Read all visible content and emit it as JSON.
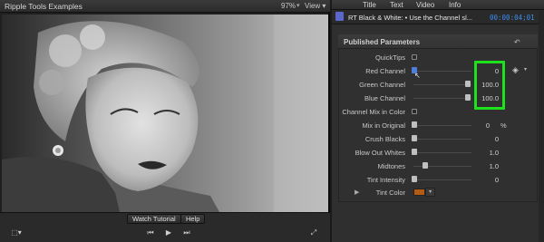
{
  "viewer": {
    "title": "Ripple Tools Examples",
    "zoom": "97%",
    "zoom_caret": "▾",
    "view_menu": "View ▾",
    "watch_tutorial": "Watch Tutorial",
    "help": "Help"
  },
  "inspector": {
    "tabs": [
      "Title",
      "Text",
      "Video",
      "Info"
    ],
    "clip_title": "RT Black & White: • Use the Channel sl...",
    "timecode": "00:00:04;01",
    "section_title": "Published Parameters",
    "params": [
      {
        "label": "QuickTips",
        "kind": "checkbox",
        "checked": false
      },
      {
        "label": "Red Channel",
        "kind": "slider",
        "value": "0",
        "unit": "",
        "level": 0.0
      },
      {
        "label": "Green Channel",
        "kind": "slider",
        "value": "100.0",
        "unit": "",
        "level": 1.0
      },
      {
        "label": "Blue Channel",
        "kind": "slider",
        "value": "100.0",
        "unit": "",
        "level": 1.0
      },
      {
        "label": "Channel Mix in Color",
        "kind": "checkbox",
        "checked": false
      },
      {
        "label": "Mix in Original",
        "kind": "slider",
        "value": "0",
        "unit": "%",
        "level": 0.0
      },
      {
        "label": "Crush Blacks",
        "kind": "slider",
        "value": "0",
        "unit": "",
        "level": 0.0
      },
      {
        "label": "Blow Out Whites",
        "kind": "slider",
        "value": "1.0",
        "unit": "",
        "level": 0.0
      },
      {
        "label": "Midtones",
        "kind": "slider",
        "value": "1.0",
        "unit": "",
        "level": 0.2
      },
      {
        "label": "Tint Intensity",
        "kind": "slider",
        "value": "0",
        "unit": "",
        "level": 0.0
      },
      {
        "label": "Tint Color",
        "kind": "color",
        "color": "#b35b13"
      }
    ]
  },
  "colors": {
    "highlight_box": "#1ee11e",
    "timecode": "#3c8df0",
    "filter_icon": "#5b67c9"
  }
}
